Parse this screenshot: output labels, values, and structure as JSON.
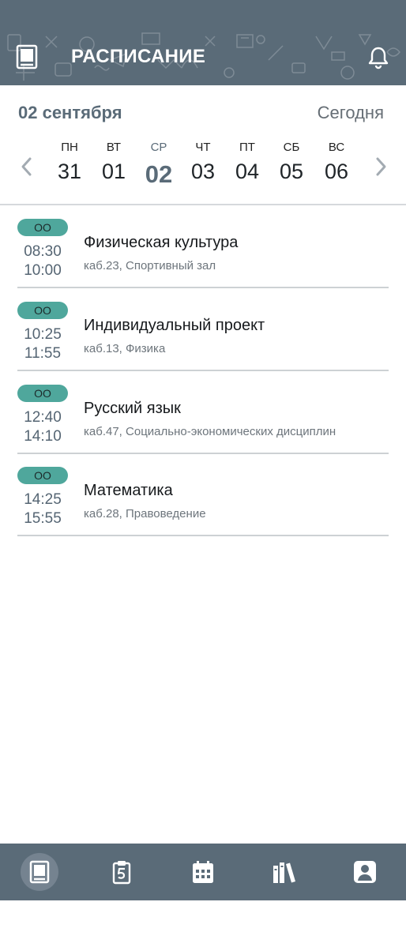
{
  "app": {
    "title": "РАСПИСАНИЕ"
  },
  "header": {
    "date": "02 сентября",
    "today_label": "Сегодня"
  },
  "week": {
    "days": [
      {
        "dow": "ПН",
        "num": "31"
      },
      {
        "dow": "ВТ",
        "num": "01"
      },
      {
        "dow": "СР",
        "num": "02",
        "active": true
      },
      {
        "dow": "ЧТ",
        "num": "03"
      },
      {
        "dow": "ПТ",
        "num": "04"
      },
      {
        "dow": "СБ",
        "num": "05"
      },
      {
        "dow": "ВС",
        "num": "06"
      }
    ]
  },
  "lessons": [
    {
      "badge": "ОО",
      "start": "08:30",
      "end": "10:00",
      "name": "Физическая культура",
      "room": "каб.23, Спортивный зал"
    },
    {
      "badge": "ОО",
      "start": "10:25",
      "end": "11:55",
      "name": "Индивидуальный проект",
      "room": "каб.13, Физика"
    },
    {
      "badge": "ОО",
      "start": "12:40",
      "end": "14:10",
      "name": "Русский язык",
      "room": "каб.47, Социально-экономических дисциплин"
    },
    {
      "badge": "ОО",
      "start": "14:25",
      "end": "15:55",
      "name": "Математика",
      "room": "каб.28, Правоведение"
    }
  ],
  "nav": {
    "items": [
      {
        "icon": "book-icon",
        "active": true
      },
      {
        "icon": "clipboard-grade-icon"
      },
      {
        "icon": "calendar-icon"
      },
      {
        "icon": "library-icon"
      },
      {
        "icon": "profile-icon"
      }
    ]
  },
  "colors": {
    "primary": "#5a6b78",
    "badge": "#4fa79c",
    "divider": "#cdd1d4"
  }
}
